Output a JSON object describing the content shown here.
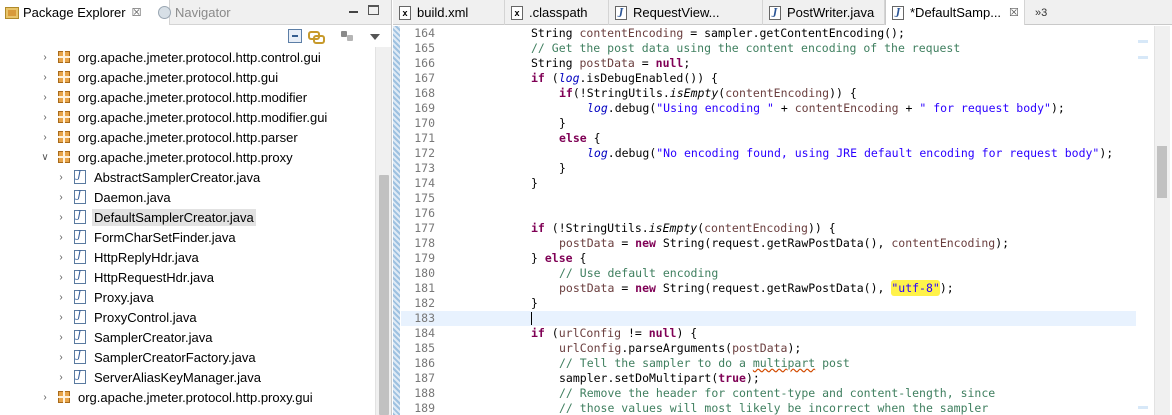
{
  "explorer": {
    "tab_label": "Package Explorer",
    "tab_close": "☒",
    "navigator_label": "Navigator",
    "tree": [
      {
        "kind": "package",
        "label": "org.apache.jmeter.protocol.http.control.gui",
        "expanded": false
      },
      {
        "kind": "package",
        "label": "org.apache.jmeter.protocol.http.gui",
        "expanded": false
      },
      {
        "kind": "package",
        "label": "org.apache.jmeter.protocol.http.modifier",
        "expanded": false
      },
      {
        "kind": "package",
        "label": "org.apache.jmeter.protocol.http.modifier.gui",
        "expanded": false
      },
      {
        "kind": "package",
        "label": "org.apache.jmeter.protocol.http.parser",
        "expanded": false
      },
      {
        "kind": "package",
        "label": "org.apache.jmeter.protocol.http.proxy",
        "expanded": true
      },
      {
        "kind": "file",
        "label": "AbstractSamplerCreator.java"
      },
      {
        "kind": "file",
        "label": "Daemon.java"
      },
      {
        "kind": "file",
        "label": "DefaultSamplerCreator.java",
        "selected": true
      },
      {
        "kind": "file",
        "label": "FormCharSetFinder.java"
      },
      {
        "kind": "file",
        "label": "HttpReplyHdr.java"
      },
      {
        "kind": "file",
        "label": "HttpRequestHdr.java"
      },
      {
        "kind": "file",
        "label": "Proxy.java"
      },
      {
        "kind": "file",
        "label": "ProxyControl.java"
      },
      {
        "kind": "file",
        "label": "SamplerCreator.java"
      },
      {
        "kind": "file",
        "label": "SamplerCreatorFactory.java"
      },
      {
        "kind": "file",
        "label": "ServerAliasKeyManager.java"
      },
      {
        "kind": "package",
        "label": "org.apache.jmeter.protocol.http.proxy.gui",
        "expanded": false
      }
    ]
  },
  "editor": {
    "tabs": [
      {
        "label": "build.xml",
        "icon": "x",
        "active": false
      },
      {
        "label": ".classpath",
        "icon": "x",
        "active": false
      },
      {
        "label": "RequestView...",
        "icon": "J",
        "active": false
      },
      {
        "label": "PostWriter.java",
        "icon": "J",
        "active": false
      },
      {
        "label": "*DefaultSamp...",
        "icon": "J",
        "active": true,
        "close": "☒"
      }
    ],
    "overflow_count": "»3",
    "current_line": 183,
    "lines": [
      {
        "n": "164",
        "indent": 0,
        "tokens": [
          [
            "t",
            "String "
          ],
          [
            "v",
            "contentEncoding"
          ],
          [
            "t",
            " = sampler.getContentEncoding();"
          ]
        ]
      },
      {
        "n": "165",
        "indent": 0,
        "tokens": [
          [
            "c",
            "// Get the post data using the content encoding of the request"
          ]
        ]
      },
      {
        "n": "166",
        "indent": 0,
        "tokens": [
          [
            "t",
            "String "
          ],
          [
            "v",
            "postData"
          ],
          [
            "t",
            " = "
          ],
          [
            "k",
            "null"
          ],
          [
            "t",
            ";"
          ]
        ]
      },
      {
        "n": "167",
        "indent": 0,
        "tokens": [
          [
            "k",
            "if"
          ],
          [
            "t",
            " ("
          ],
          [
            "f",
            "log"
          ],
          [
            "t",
            ".isDebugEnabled()) {"
          ]
        ]
      },
      {
        "n": "168",
        "indent": 1,
        "tokens": [
          [
            "k",
            "if"
          ],
          [
            "t",
            "(!StringUtils."
          ],
          [
            "i",
            "isEmpty"
          ],
          [
            "t",
            "("
          ],
          [
            "v",
            "contentEncoding"
          ],
          [
            "t",
            ")) {"
          ]
        ]
      },
      {
        "n": "169",
        "indent": 2,
        "tokens": [
          [
            "f",
            "log"
          ],
          [
            "t",
            ".debug("
          ],
          [
            "s",
            "\"Using encoding \""
          ],
          [
            "t",
            " + "
          ],
          [
            "v",
            "contentEncoding"
          ],
          [
            "t",
            " + "
          ],
          [
            "s",
            "\" for request body\""
          ],
          [
            "t",
            ");"
          ]
        ]
      },
      {
        "n": "170",
        "indent": 1,
        "tokens": [
          [
            "t",
            "}"
          ]
        ]
      },
      {
        "n": "171",
        "indent": 1,
        "tokens": [
          [
            "k",
            "else"
          ],
          [
            "t",
            " {"
          ]
        ]
      },
      {
        "n": "172",
        "indent": 2,
        "tokens": [
          [
            "f",
            "log"
          ],
          [
            "t",
            ".debug("
          ],
          [
            "s",
            "\"No encoding found, using JRE default encoding for request body\""
          ],
          [
            "t",
            ");"
          ]
        ]
      },
      {
        "n": "173",
        "indent": 1,
        "tokens": [
          [
            "t",
            "}"
          ]
        ]
      },
      {
        "n": "174",
        "indent": 0,
        "tokens": [
          [
            "t",
            "}"
          ]
        ]
      },
      {
        "n": "175",
        "indent": 0,
        "tokens": []
      },
      {
        "n": "176",
        "indent": 0,
        "tokens": []
      },
      {
        "n": "177",
        "indent": 0,
        "tokens": [
          [
            "k",
            "if"
          ],
          [
            "t",
            " (!StringUtils."
          ],
          [
            "i",
            "isEmpty"
          ],
          [
            "t",
            "("
          ],
          [
            "v",
            "contentEncoding"
          ],
          [
            "t",
            ")) {"
          ]
        ]
      },
      {
        "n": "178",
        "indent": 1,
        "tokens": [
          [
            "v",
            "postData"
          ],
          [
            "t",
            " = "
          ],
          [
            "k",
            "new"
          ],
          [
            "t",
            " String(request.getRawPostData(), "
          ],
          [
            "v",
            "contentEncoding"
          ],
          [
            "t",
            ");"
          ]
        ]
      },
      {
        "n": "179",
        "indent": 0,
        "tokens": [
          [
            "t",
            "} "
          ],
          [
            "k",
            "else"
          ],
          [
            "t",
            " {"
          ]
        ]
      },
      {
        "n": "180",
        "indent": 1,
        "tokens": [
          [
            "c",
            "// Use default encoding"
          ]
        ]
      },
      {
        "n": "181",
        "indent": 1,
        "tokens": [
          [
            "v",
            "postData"
          ],
          [
            "t",
            " = "
          ],
          [
            "k",
            "new"
          ],
          [
            "t",
            " String(request.getRawPostData(), "
          ],
          [
            "h",
            "\"utf-8\""
          ],
          [
            "t",
            ");"
          ]
        ]
      },
      {
        "n": "182",
        "indent": 0,
        "tokens": [
          [
            "t",
            "}"
          ]
        ]
      },
      {
        "n": "183",
        "indent": 0,
        "tokens": [
          [
            "caret",
            ""
          ]
        ]
      },
      {
        "n": "184",
        "indent": 0,
        "tokens": [
          [
            "k",
            "if"
          ],
          [
            "t",
            " ("
          ],
          [
            "v",
            "urlConfig"
          ],
          [
            "t",
            " != "
          ],
          [
            "k",
            "null"
          ],
          [
            "t",
            ") {"
          ]
        ]
      },
      {
        "n": "185",
        "indent": 1,
        "tokens": [
          [
            "v",
            "urlConfig"
          ],
          [
            "t",
            ".parseArguments("
          ],
          [
            "v",
            "postData"
          ],
          [
            "t",
            ");"
          ]
        ]
      },
      {
        "n": "186",
        "indent": 1,
        "tokens": [
          [
            "c",
            "// Tell the sampler to do a "
          ],
          [
            "cw",
            "multipart"
          ],
          [
            "c",
            " post"
          ]
        ]
      },
      {
        "n": "187",
        "indent": 1,
        "tokens": [
          [
            "t",
            "sampler.setDoMultipart("
          ],
          [
            "k",
            "true"
          ],
          [
            "t",
            ");"
          ]
        ]
      },
      {
        "n": "188",
        "indent": 1,
        "tokens": [
          [
            "c",
            "// Remove the header for content-type and content-length, since"
          ]
        ]
      },
      {
        "n": "189",
        "indent": 1,
        "tokens": [
          [
            "c",
            "// those values will most likely be incorrect when the sampler"
          ]
        ]
      }
    ]
  },
  "colors": {
    "keyword": "#7f0055",
    "comment": "#3f7f5f",
    "string": "#2a00ff",
    "field": "#0000c0",
    "highlight": "#fff24a",
    "current_line": "#e8f2fe"
  }
}
